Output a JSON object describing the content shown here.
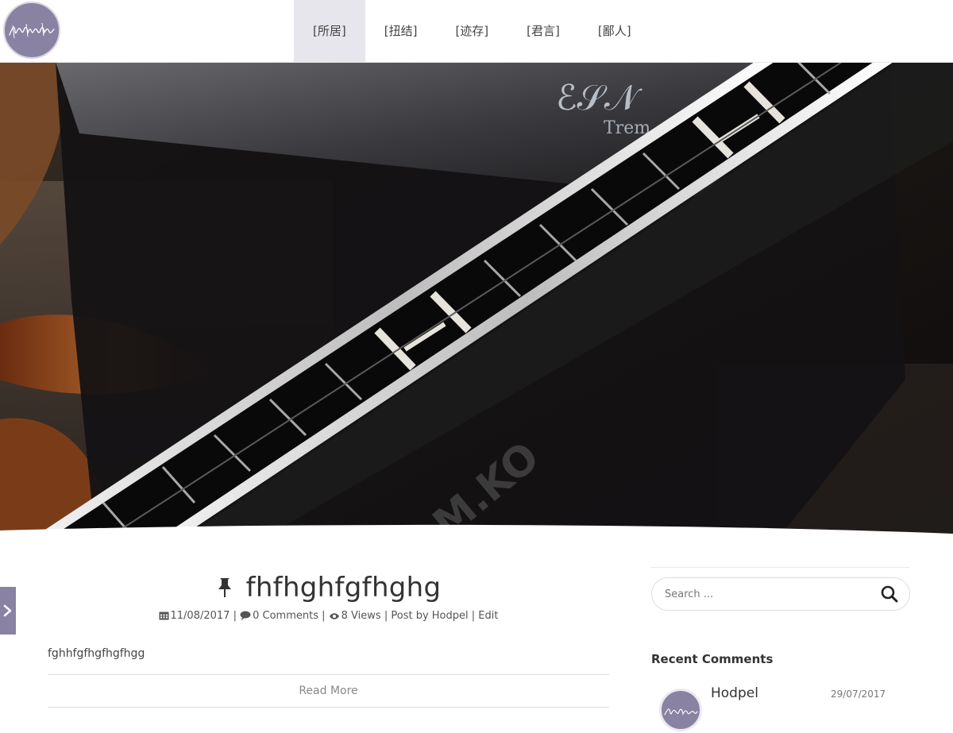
{
  "nav": {
    "items": [
      {
        "label": "[所居]",
        "active": true
      },
      {
        "label": "[扭结]",
        "active": false
      },
      {
        "label": "[迹存]",
        "active": false
      },
      {
        "label": "[君言]",
        "active": false
      },
      {
        "label": "[鄙人]",
        "active": false
      }
    ]
  },
  "post": {
    "title": "fhfhghfgfhghg",
    "date": "11/08/2017",
    "comments": "0 Comments",
    "views": "8 Views",
    "post_by_prefix": "Post by",
    "author": "Hodpel",
    "edit": "Edit",
    "separator": "|",
    "excerpt": "fghhfgfhgfhgfhgg",
    "read_more": "Read More"
  },
  "sidebar": {
    "search_placeholder": "Search ...",
    "recent_comments_title": "Recent Comments",
    "recent_comments": [
      {
        "author": "Hodpel",
        "date": "29/07/2017"
      }
    ]
  },
  "colors": {
    "accent": "#8a82a3",
    "nav_active_bg": "#e8e6ed"
  }
}
